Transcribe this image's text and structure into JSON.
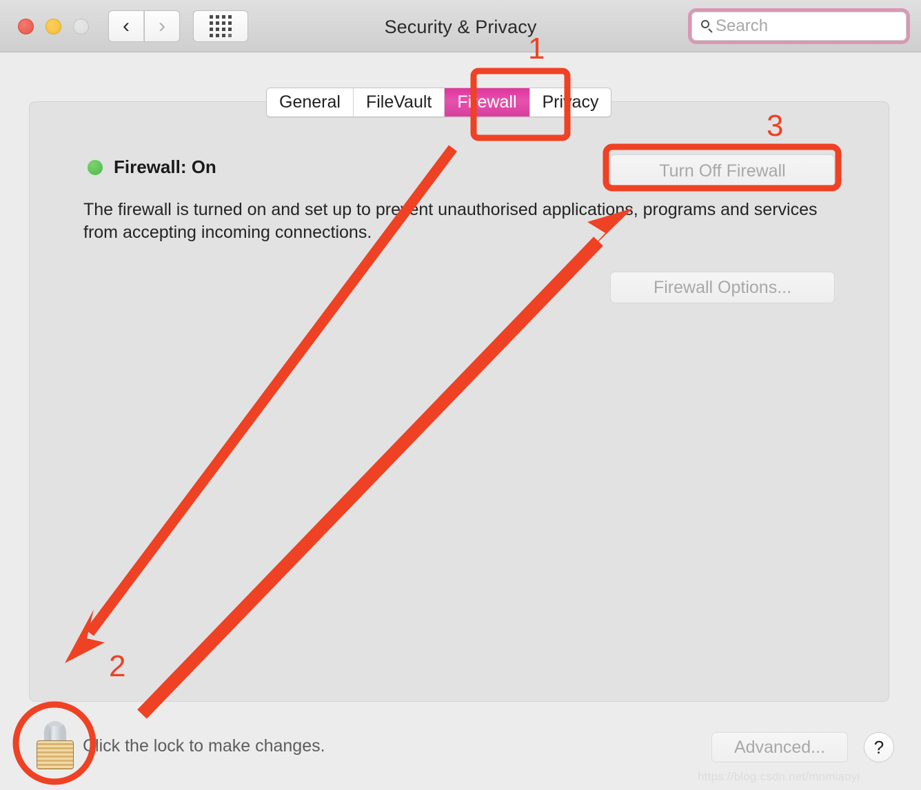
{
  "window": {
    "title": "Security & Privacy",
    "traffic_lights": [
      {
        "name": "close",
        "color": "#e8574b"
      },
      {
        "name": "minimize",
        "color": "#f5bc33"
      },
      {
        "name": "zoom",
        "color": "#dcdcdc"
      }
    ],
    "nav": {
      "back_icon": "chevron-left-icon",
      "back_glyph": "‹",
      "forward_icon": "chevron-right-icon",
      "forward_glyph": "›",
      "grid_icon": "grid-dots-icon"
    }
  },
  "search": {
    "icon": "search-icon",
    "placeholder": "Search",
    "value": "",
    "highlight_color": "#d898b4"
  },
  "tabs": [
    {
      "label": "General",
      "selected": false
    },
    {
      "label": "FileVault",
      "selected": false
    },
    {
      "label": "Firewall",
      "selected": true
    },
    {
      "label": "Privacy",
      "selected": false
    }
  ],
  "tab_selected_color": "#e0359d",
  "firewall": {
    "status_dot_color": "#4cb946",
    "status_label": "Firewall: On",
    "description": "The firewall is turned on and set up to prevent unauthorised applications, programs and services from accepting incoming connections.",
    "turn_off_button": "Turn Off Firewall",
    "options_button": "Firewall Options...",
    "buttons_disabled": true
  },
  "bottom": {
    "lock_icon": "padlock-closed-icon",
    "lock_text": "Click the lock to make changes.",
    "advanced_button": "Advanced...",
    "help_button": "?",
    "watermark": "https://blog.csdn.net/mnmiaoyi"
  },
  "annotations": {
    "color": "#ef4123",
    "numbers": [
      {
        "label": "1",
        "target": "firewall-tab"
      },
      {
        "label": "2",
        "target": "lock-button"
      },
      {
        "label": "3",
        "target": "turn-off-firewall-button"
      }
    ]
  }
}
